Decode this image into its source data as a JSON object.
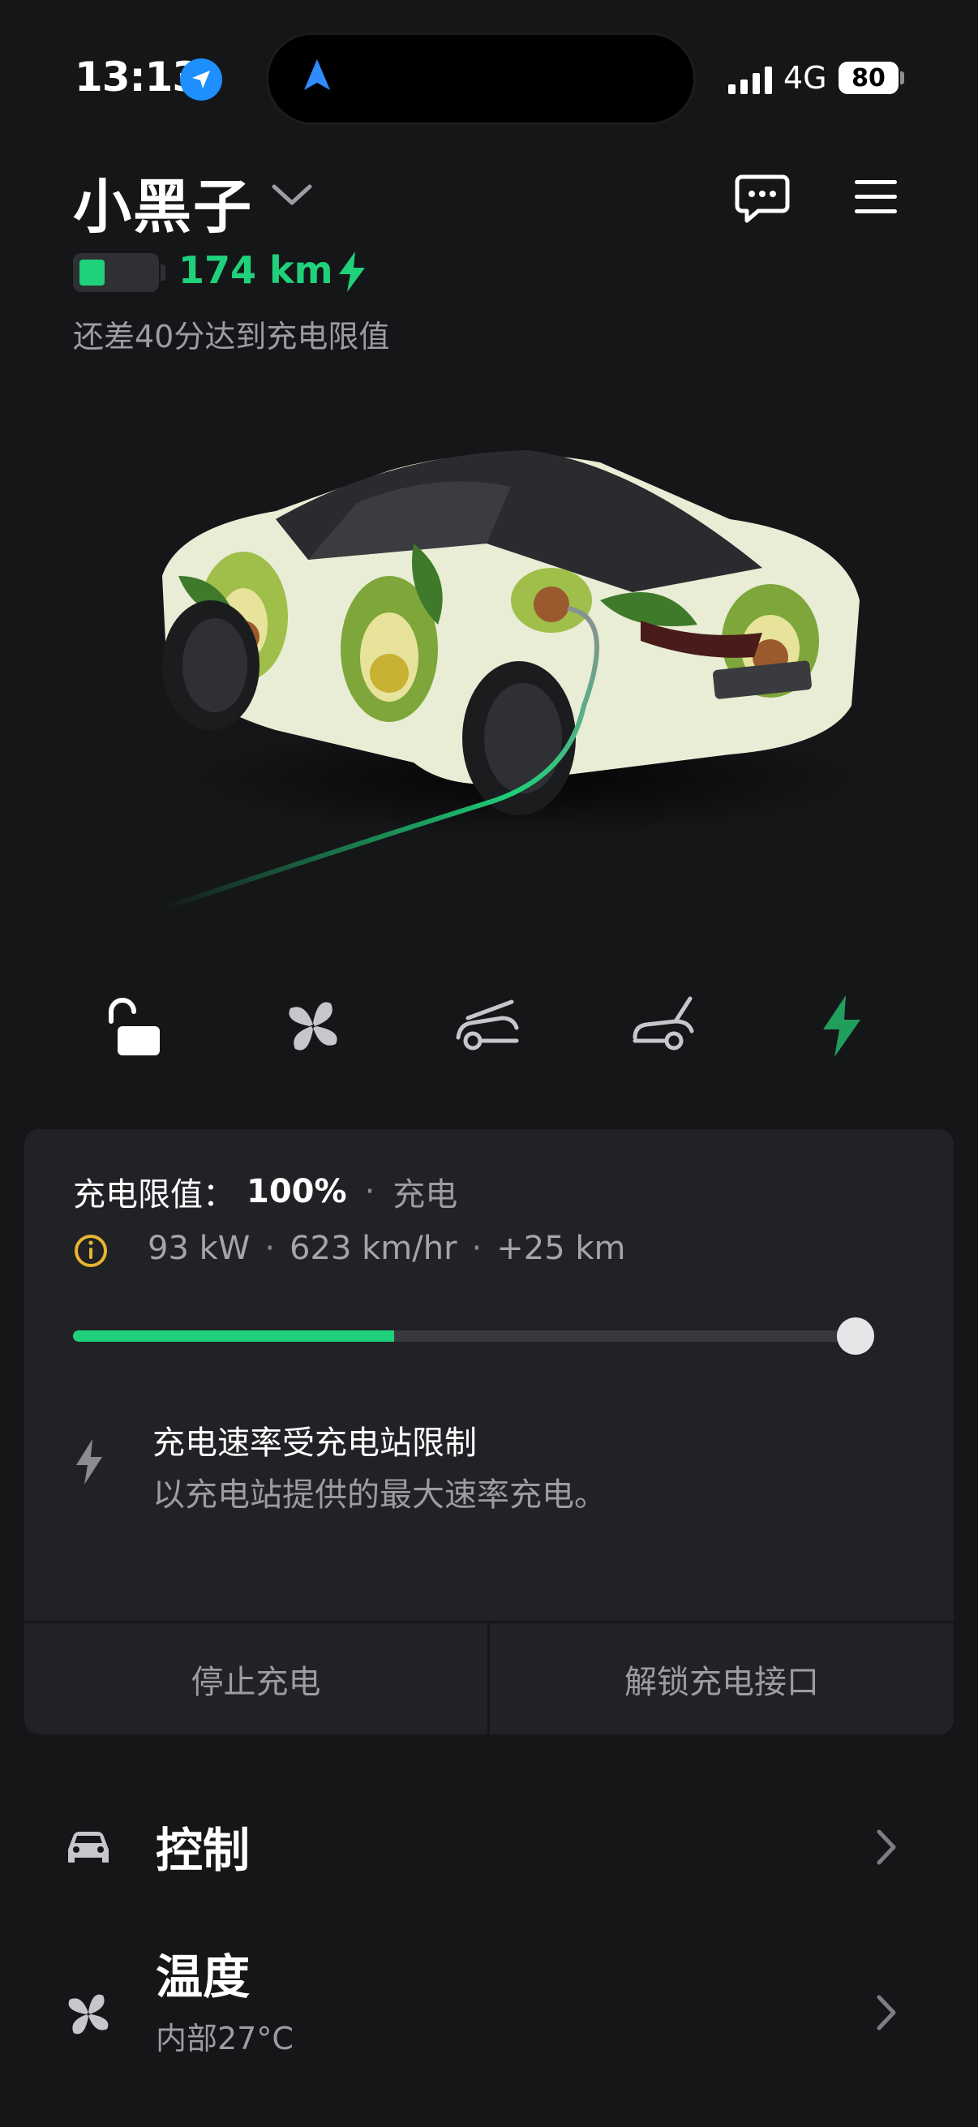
{
  "status_bar": {
    "time": "13:13",
    "network": "4G",
    "battery_level": "80"
  },
  "header": {
    "car_name": "小黑子",
    "range": "174 km",
    "battery_fraction": 0.35,
    "charge_time_text": "还差40分达到充电限值"
  },
  "quick_controls": [
    {
      "name": "unlock",
      "icon": "lock-open-icon",
      "active": false
    },
    {
      "name": "climate",
      "icon": "fan-icon",
      "active": false
    },
    {
      "name": "frunk",
      "icon": "frunk-icon",
      "active": false
    },
    {
      "name": "trunk",
      "icon": "trunk-icon",
      "active": false
    },
    {
      "name": "charge",
      "icon": "bolt-icon",
      "active": true
    }
  ],
  "charge_card": {
    "limit_label": "充电限值：",
    "limit_value": "100%",
    "status": "充电",
    "power": "93 kW",
    "rate": "623 km/hr",
    "added": "+25 km",
    "current_level_fraction": 0.41,
    "limit_fraction": 1.0,
    "notice_title": "充电速率受充电站限制",
    "notice_body": "以充电站提供的最大速率充电。",
    "stop_button": "停止充电",
    "unlock_port_button": "解锁充电接口"
  },
  "list": {
    "controls_label": "控制",
    "climate_label": "温度",
    "climate_sub": "内部27°C"
  },
  "colors": {
    "background": "#151618",
    "card": "#212225",
    "accent_green": "#1fd17a",
    "info_yellow": "#e8b531",
    "secondary_text": "#9c9da1"
  }
}
